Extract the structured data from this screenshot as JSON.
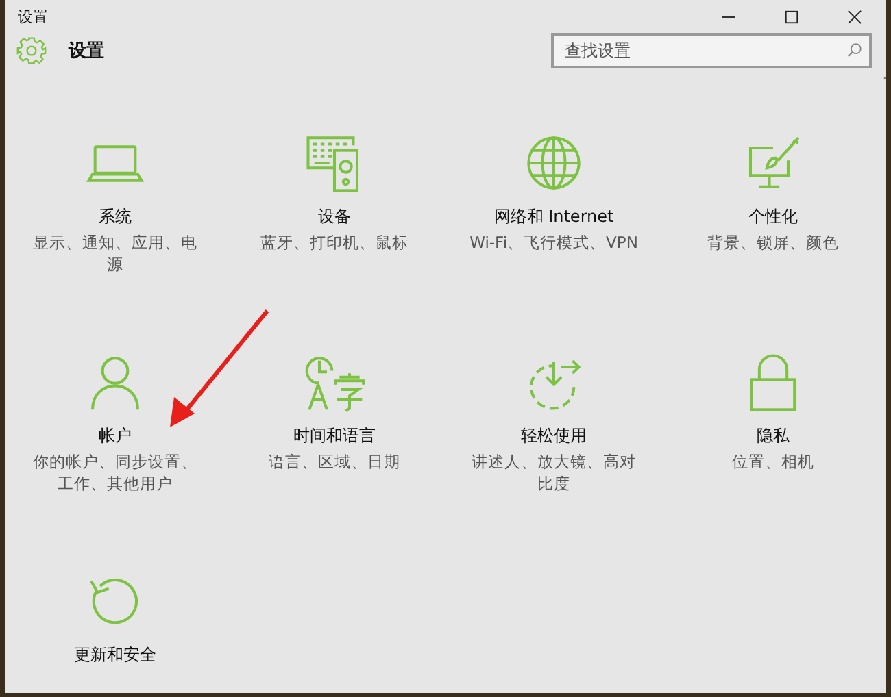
{
  "window": {
    "title": "设置",
    "controls": [
      {
        "kind": "minimize"
      },
      {
        "kind": "maximize"
      },
      {
        "kind": "close"
      }
    ]
  },
  "header": {
    "title": "设置",
    "search": {
      "placeholder": "查找设置"
    }
  },
  "tiles": [
    {
      "kind": "laptop",
      "title": "系统",
      "description": "显示、通知、应用、电源"
    },
    {
      "kind": "devices",
      "title": "设备",
      "description": "蓝牙、打印机、鼠标"
    },
    {
      "kind": "globe",
      "title": "网络和 Internet",
      "description": "Wi-Fi、飞行模式、VPN"
    },
    {
      "kind": "paint",
      "title": "个性化",
      "description": "背景、锁屏、颜色"
    },
    {
      "kind": "person",
      "title": "帐户",
      "description": "你的帐户、同步设置、工作、其他用户"
    },
    {
      "kind": "clock-lang",
      "title": "时间和语言",
      "description": "语言、区域、日期"
    },
    {
      "kind": "ease",
      "title": "轻松使用",
      "description": "讲述人、放大镜、高对比度"
    },
    {
      "kind": "lock",
      "title": "隐私",
      "description": "位置、相机"
    },
    {
      "kind": "update",
      "title": "更新和安全"
    }
  ]
}
